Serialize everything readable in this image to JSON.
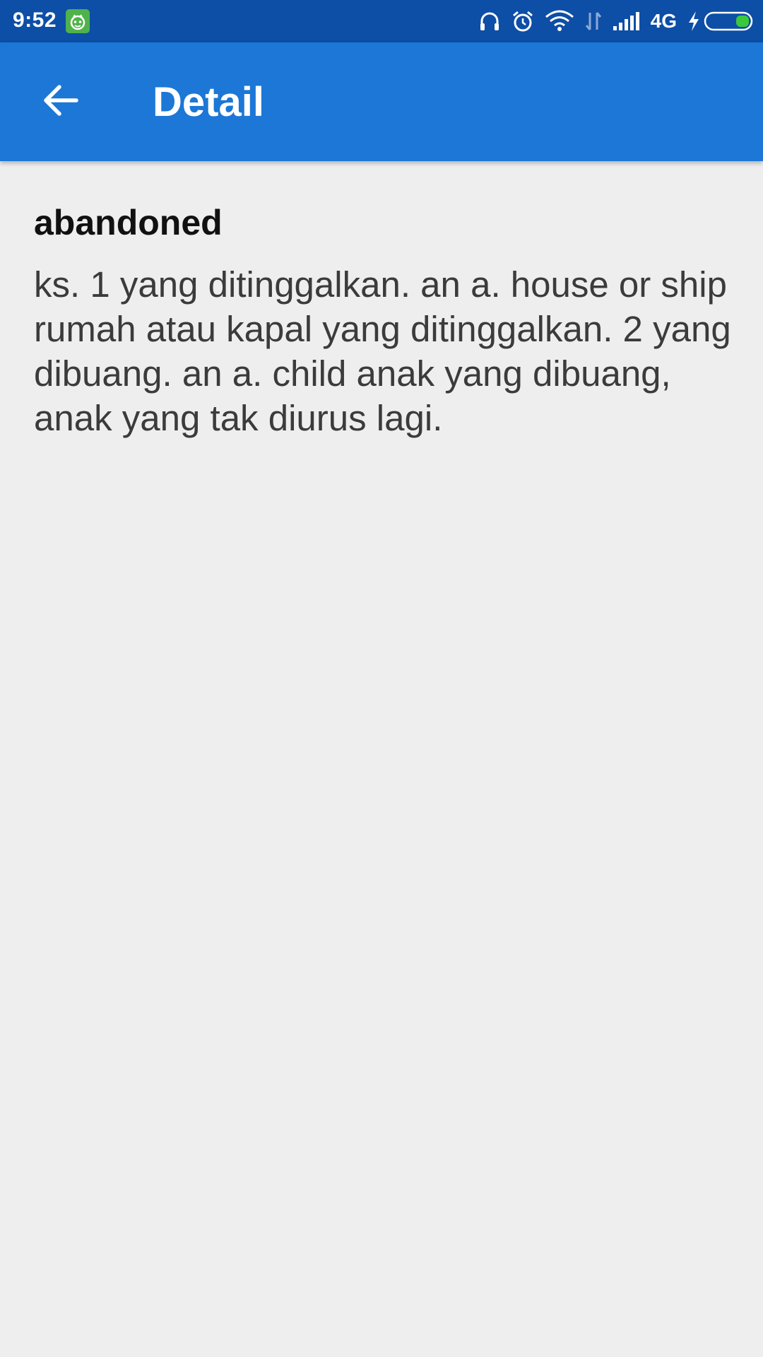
{
  "status_bar": {
    "time": "9:52",
    "network": "4G",
    "icons": [
      "notification-app-icon",
      "headphones-icon",
      "alarm-icon",
      "wifi-icon",
      "data-transfer-icon",
      "signal-icon",
      "charging-icon",
      "battery-icon"
    ],
    "colors": {
      "background": "#0d4ea6",
      "battery_level": "#3cc83c"
    }
  },
  "app_bar": {
    "title": "Detail",
    "back_icon": "arrow-back-icon",
    "color": "#1c77d6"
  },
  "entry": {
    "word": "abandoned",
    "definition": "ks. 1 yang ditinggalkan. an a. house or ship rumah atau kapal yang ditinggalkan. 2 yang dibuang. an a. child anak yang dibuang, anak yang tak diurus lagi."
  },
  "colors": {
    "page_background": "#eeeeef"
  }
}
